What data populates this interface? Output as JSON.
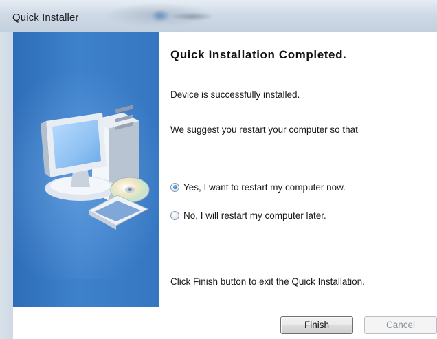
{
  "window": {
    "title": "Quick Installer"
  },
  "content": {
    "heading": "Quick Installation Completed.",
    "status_line": "Device is successfully installed.",
    "suggest_line": "We suggest you restart your computer so that",
    "footer_line": "Click Finish button to exit the Quick Installation."
  },
  "options": [
    {
      "label": "Yes, I want to restart my computer now.",
      "checked": true
    },
    {
      "label": "No, I will restart my computer later.",
      "checked": false
    }
  ],
  "buttons": {
    "finish_label": "Finish",
    "cancel_label": "Cancel",
    "cancel_enabled": false
  },
  "icons": {
    "side_illustration": "computer-cd-icon"
  },
  "colors": {
    "side_panel": "#3a7bc8",
    "selected_radio": "#2c7fd4"
  }
}
